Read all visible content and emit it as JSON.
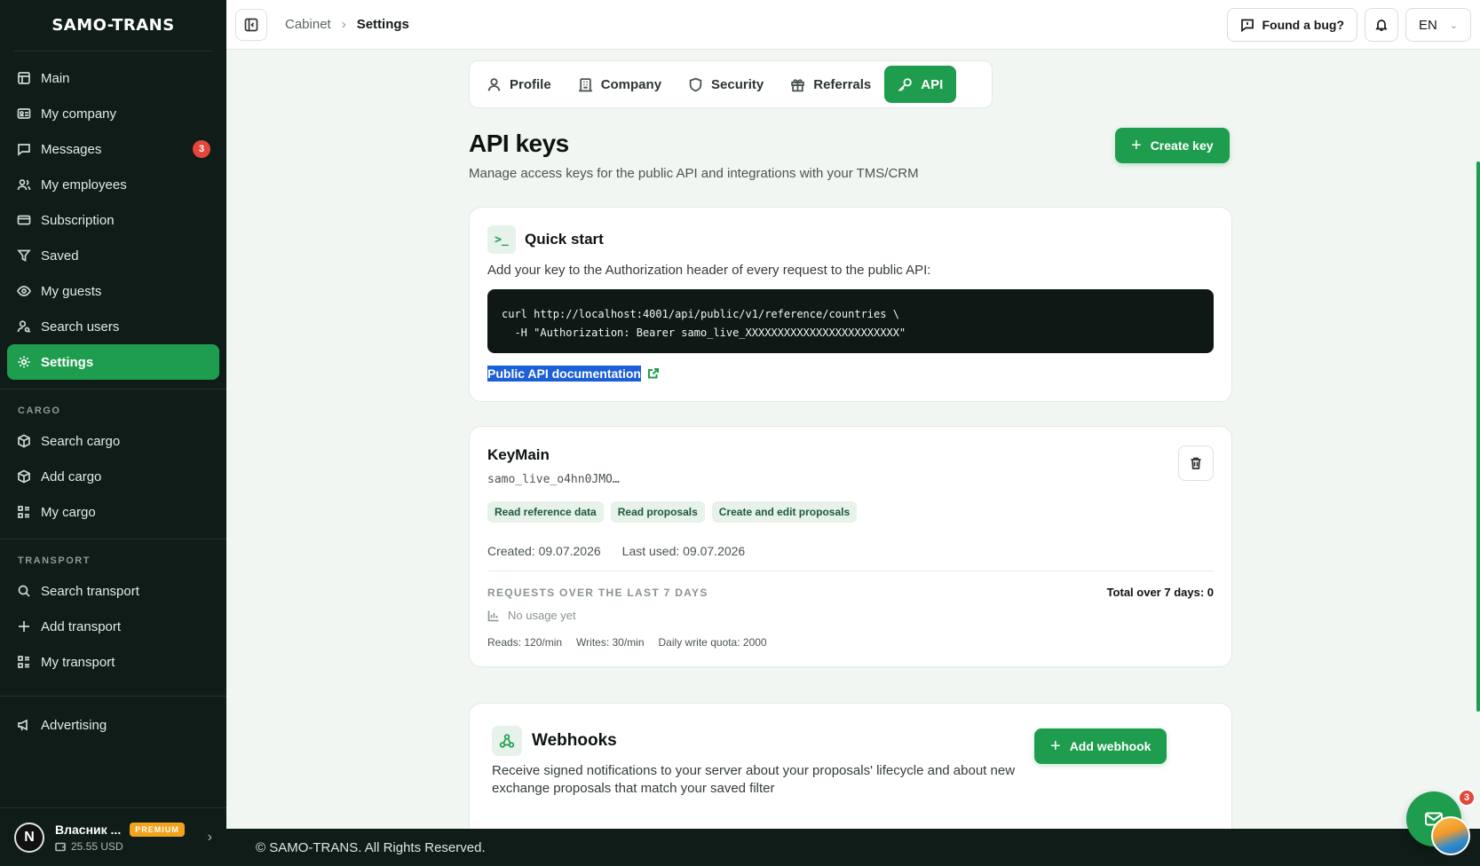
{
  "brand": "SAMO-TRANS",
  "sidebar": {
    "items": [
      {
        "label": "Main",
        "icon": "table-icon"
      },
      {
        "label": "My company",
        "icon": "id-card-icon"
      },
      {
        "label": "Messages",
        "icon": "chat-icon",
        "badge": "3"
      },
      {
        "label": "My employees",
        "icon": "users-icon"
      },
      {
        "label": "Subscription",
        "icon": "card-icon"
      },
      {
        "label": "Saved",
        "icon": "filter-icon"
      },
      {
        "label": "My guests",
        "icon": "eye-icon"
      },
      {
        "label": "Search users",
        "icon": "user-search-icon"
      },
      {
        "label": "Settings",
        "icon": "gear-icon",
        "active": true
      }
    ],
    "cargo_label": "CARGO",
    "cargo_items": [
      {
        "label": "Search cargo",
        "icon": "box-search-icon"
      },
      {
        "label": "Add cargo",
        "icon": "box-add-icon"
      },
      {
        "label": "My cargo",
        "icon": "list-icon"
      }
    ],
    "transport_label": "TRANSPORT",
    "transport_items": [
      {
        "label": "Search transport",
        "icon": "search-icon"
      },
      {
        "label": "Add transport",
        "icon": "plus-icon"
      },
      {
        "label": "My transport",
        "icon": "list-icon"
      }
    ],
    "advertising": "Advertising",
    "user": {
      "initial": "N",
      "name": "Власник ...",
      "plan": "PREMIUM",
      "balance": "25.55 USD"
    }
  },
  "topbar": {
    "crumb_parent": "Cabinet",
    "crumb_sep": "›",
    "crumb_current": "Settings",
    "bug_label": "Found a bug?",
    "lang": "EN"
  },
  "tabs": [
    {
      "label": "Profile",
      "icon": "user-icon"
    },
    {
      "label": "Company",
      "icon": "building-icon"
    },
    {
      "label": "Security",
      "icon": "shield-icon"
    },
    {
      "label": "Referrals",
      "icon": "gift-icon"
    },
    {
      "label": "API",
      "icon": "key-icon",
      "active": true
    }
  ],
  "page": {
    "title": "API keys",
    "subtitle": "Manage access keys for the public API and integrations with your TMS/CRM",
    "create_key": "Create key"
  },
  "quick_start": {
    "icon_text": ">_",
    "title": "Quick start",
    "description": "Add your key to the Authorization header of every request to the public API:",
    "code_line1": "curl http://localhost:4001/api/public/v1/reference/countries \\",
    "code_line2": "  -H \"Authorization: Bearer samo_live_XXXXXXXXXXXXXXXXXXXXXXXX\"",
    "doc_link": "Public API documentation"
  },
  "key": {
    "name": "KeyMain",
    "token": "samo_live_o4hn0JMO…",
    "permissions": [
      "Read reference data",
      "Read proposals",
      "Create and edit proposals"
    ],
    "created": "Created: 09.07.2026",
    "last_used": "Last used: 09.07.2026",
    "requests_label": "REQUESTS OVER THE LAST 7 DAYS",
    "total": "Total over 7 days: 0",
    "no_usage": "No usage yet",
    "reads": "Reads: 120/min",
    "writes": "Writes: 30/min",
    "quota": "Daily write quota: 2000"
  },
  "webhooks": {
    "title": "Webhooks",
    "description": "Receive signed notifications to your server about your proposals' lifecycle and about new exchange proposals that match your saved filter",
    "add_label": "Add webhook"
  },
  "footer": "© SAMO-TRANS. All Rights Reserved.",
  "chat": {
    "badge": "3"
  },
  "colors": {
    "accent": "#1f9d4e",
    "sidebar_bg": "#0f1c17",
    "badge": "#e2473b",
    "premium": "#f0a31b"
  }
}
